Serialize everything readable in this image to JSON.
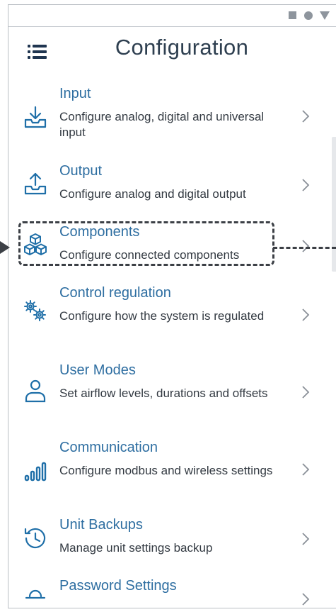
{
  "header": {
    "title": "Configuration",
    "menu_icon": "hamburger-menu-icon"
  },
  "status_bar": {
    "icons": [
      "square-icon",
      "circle-icon",
      "triangle-icon"
    ],
    "color": "#8e959d"
  },
  "menu_items": [
    {
      "title": "Input",
      "description": "Configure analog, digital and universal input",
      "icon": "download-tray-icon"
    },
    {
      "title": "Output",
      "description": "Configure analog and digital output",
      "icon": "upload-tray-icon"
    },
    {
      "title": "Components",
      "description": "Configure connected components",
      "icon": "cubes-icon"
    },
    {
      "title": "Control regulation",
      "description": "Configure how the system is regulated",
      "icon": "gears-icon"
    },
    {
      "title": "User Modes",
      "description": "Set airflow levels, durations and offsets",
      "icon": "user-icon"
    },
    {
      "title": "Communication",
      "description": "Configure modbus and wireless settings",
      "icon": "signal-bars-icon"
    },
    {
      "title": "Unit Backups",
      "description": "Manage unit settings backup",
      "icon": "history-icon"
    },
    {
      "title": "Password Settings",
      "description": "",
      "icon": "lock-icon"
    }
  ],
  "colors": {
    "title_text": "#2e3f50",
    "item_title": "#2e6ea1",
    "icon_blue": "#1f6fa8",
    "description": "#333a42",
    "annotation": "#3c4046"
  }
}
